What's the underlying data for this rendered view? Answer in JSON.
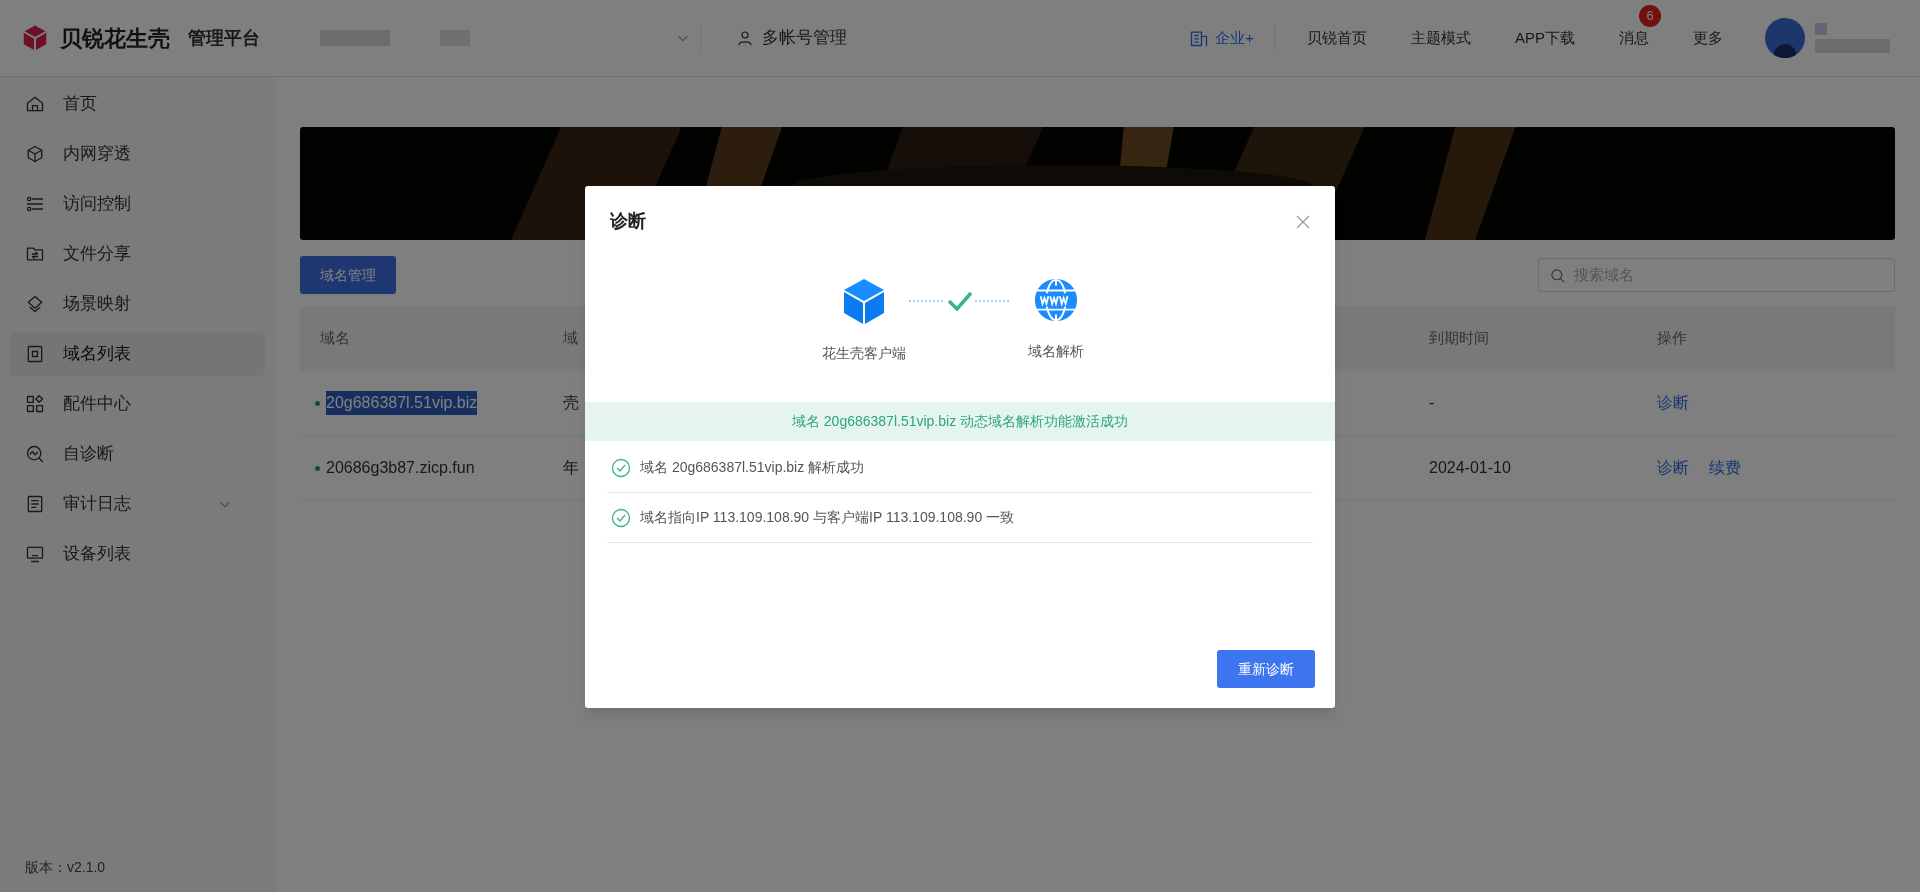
{
  "header": {
    "brand": "贝锐花生壳",
    "platform": "管理平台",
    "multi_account": "多帐号管理",
    "enterprise": "企业+",
    "nav": [
      "贝锐首页",
      "主题模式",
      "APP下载"
    ],
    "messages": {
      "label": "消息",
      "badge": "6"
    },
    "more": "更多"
  },
  "sidebar": {
    "items": [
      {
        "label": "首页",
        "selected": false,
        "has_submenu": false
      },
      {
        "label": "内网穿透",
        "selected": false,
        "has_submenu": false
      },
      {
        "label": "访问控制",
        "selected": false,
        "has_submenu": false
      },
      {
        "label": "文件分享",
        "selected": false,
        "has_submenu": false
      },
      {
        "label": "场景映射",
        "selected": false,
        "has_submenu": false
      },
      {
        "label": "域名列表",
        "selected": true,
        "has_submenu": false
      },
      {
        "label": "配件中心",
        "selected": false,
        "has_submenu": false
      },
      {
        "label": "自诊断",
        "selected": false,
        "has_submenu": false
      },
      {
        "label": "审计日志",
        "selected": false,
        "has_submenu": true
      },
      {
        "label": "设备列表",
        "selected": false,
        "has_submenu": false
      }
    ],
    "version": "版本：v2.1.0"
  },
  "toolbar": {
    "button": "域名管理",
    "search": {
      "placeholder": "搜索域名"
    }
  },
  "table": {
    "columns": [
      "域名",
      "域",
      "到期时间",
      "操作"
    ],
    "rows": [
      {
        "domain": "20g686387l.51vip.biz",
        "highlighted": true,
        "column_2": "壳",
        "expiry": "-",
        "actions": [
          "诊断"
        ]
      },
      {
        "domain": "20686g3b87.zicp.fun",
        "highlighted": false,
        "column_2": "年",
        "expiry": "2024-01-10",
        "actions": [
          "诊断",
          "续费"
        ]
      }
    ]
  },
  "dialog": {
    "title": "诊断",
    "steps": [
      {
        "label": "花生壳客户端"
      },
      {
        "label": "域名解析"
      }
    ],
    "connected": true,
    "success_message": "域名 20g686387l.51vip.biz 动态域名解析功能激活成功",
    "checks": [
      {
        "text": "域名 20g686387l.51vip.biz 解析成功",
        "passed": true
      },
      {
        "text": "域名指向IP 113.109.108.90 与客户端IP 113.109.108.90 一致",
        "passed": true
      }
    ],
    "button": "重新诊断"
  }
}
